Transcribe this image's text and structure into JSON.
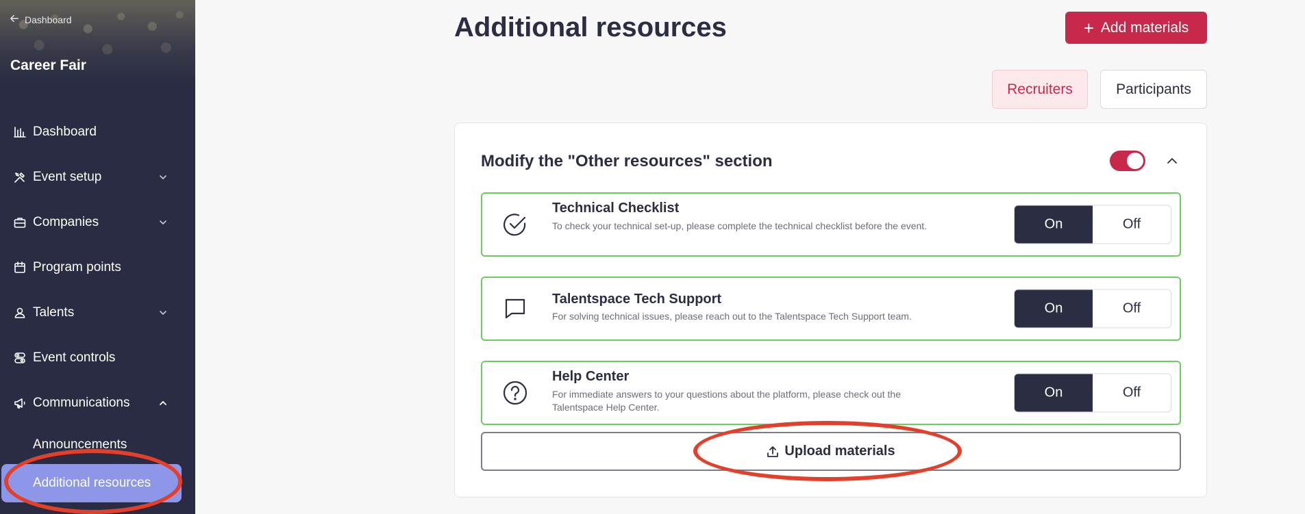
{
  "sidebar": {
    "back_label": "Dashboard",
    "event_title": "Career Fair",
    "items": [
      {
        "label": "Dashboard",
        "icon": "bar-chart-icon",
        "expandable": false
      },
      {
        "label": "Event setup",
        "icon": "tools-icon",
        "expandable": true,
        "expanded": false
      },
      {
        "label": "Companies",
        "icon": "briefcase-icon",
        "expandable": true,
        "expanded": false
      },
      {
        "label": "Program points",
        "icon": "calendar-icon",
        "expandable": false
      },
      {
        "label": "Talents",
        "icon": "user-icon",
        "expandable": true,
        "expanded": false
      },
      {
        "label": "Event controls",
        "icon": "controls-icon",
        "expandable": false
      },
      {
        "label": "Communications",
        "icon": "megaphone-icon",
        "expandable": true,
        "expanded": true
      }
    ],
    "sub_items": [
      {
        "label": "Announcements",
        "active": false
      },
      {
        "label": "Additional resources",
        "active": true
      }
    ]
  },
  "main": {
    "title": "Additional resources",
    "add_button_label": "Add materials",
    "tabs": [
      {
        "label": "Recruiters",
        "active": true
      },
      {
        "label": "Participants",
        "active": false
      }
    ],
    "section": {
      "title": "Modify the \"Other resources\" section",
      "enabled": true,
      "resources": [
        {
          "icon": "check-circle-icon",
          "title": "Technical Checklist",
          "description": "To check your technical set-up, please complete the technical checklist before the event.",
          "state": "On"
        },
        {
          "icon": "chat-bubble-icon",
          "title": "Talentspace Tech Support",
          "description": "For solving technical issues, please reach out to the Talentspace Tech Support team.",
          "state": "On"
        },
        {
          "icon": "question-circle-icon",
          "title": "Help Center",
          "description": "For immediate answers to your questions about the platform, please check out the Talentspace Help Center.",
          "state": "On"
        }
      ],
      "on_label": "On",
      "off_label": "Off",
      "upload_label": "Upload materials"
    }
  },
  "colors": {
    "sidebar_bg": "#2a2c43",
    "accent": "#c8294a",
    "active_nav": "#8e96e8",
    "resource_border": "#6ccb5f",
    "annotation": "#e2402a"
  }
}
